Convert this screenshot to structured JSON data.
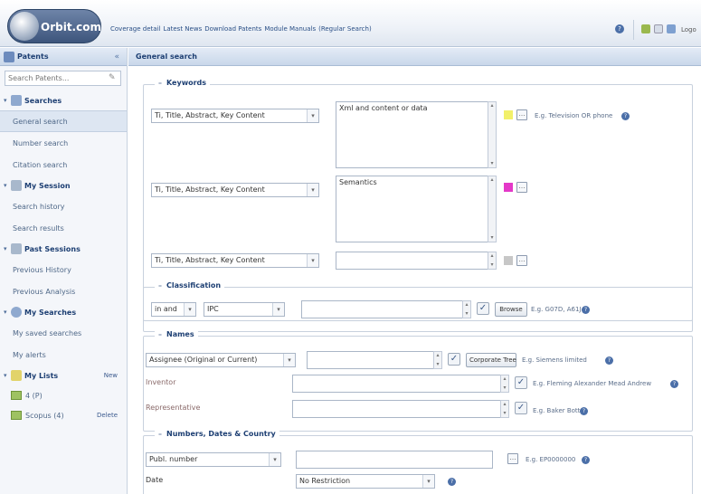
{
  "app": {
    "logo_text": "Orbit.com"
  },
  "top_links": [
    "Coverage detail",
    "Latest News",
    "Download Patents",
    "Module Manuals",
    "(Regular Search)"
  ],
  "top_right": {
    "text": "Logo"
  },
  "left_panel": {
    "title": "Patents",
    "collapse": "«",
    "search_placeholder": "Search Patents...",
    "groups": [
      {
        "label": "Searches",
        "items": [
          "General search",
          "Number search",
          "Citation search"
        ]
      },
      {
        "label": "My Session",
        "items": [
          "Search history",
          "Search results"
        ]
      },
      {
        "label": "Past Sessions",
        "items": [
          "Previous History",
          "Previous Analysis"
        ]
      },
      {
        "label": "My Searches",
        "items": [
          "My saved searches",
          "My alerts"
        ]
      },
      {
        "label": "My Lists",
        "action": "New",
        "items": []
      }
    ],
    "list_folders": [
      {
        "label": "4 (P)",
        "action": ""
      },
      {
        "label": "Scopus (4)",
        "action": "Delete"
      }
    ]
  },
  "main": {
    "title": "General search",
    "keywords": {
      "legend": "Keywords",
      "rows": [
        {
          "field": "Ti, Title, Abstract, Key Content",
          "value": "Xml and content or data",
          "color": "#f2f06a",
          "example": "E.g. Television OR phone"
        },
        {
          "field": "Ti, Title, Abstract, Key Content",
          "value": "Semantics",
          "color": "#e438c8",
          "example": ""
        },
        {
          "field": "Ti, Title, Abstract, Key Content",
          "value": "",
          "color": "#c7c7c7",
          "example": ""
        }
      ]
    },
    "classification": {
      "legend": "Classification",
      "operator": "in and",
      "scheme": "IPC",
      "browse": "Browse",
      "example": "E.g. G07D, A61J"
    },
    "names": {
      "legend": "Names",
      "field": "Assignee (Original or Current)",
      "corporate": "Corporate Tree",
      "example1": "E.g. Siemens limited",
      "inventor": "Inventor",
      "example2": "E.g. Fleming Alexander Mead Andrew",
      "representative": "Representative",
      "example3": "E.g. Baker Botts"
    },
    "numbers": {
      "legend": "Numbers, Dates & Country",
      "field": "Publ. number",
      "example": "E.g. EP0000000",
      "date_label": "Date",
      "date_value": "No Restriction"
    }
  },
  "colors": {
    "accent": "#1d3f73",
    "header": "#c9d7ea"
  }
}
